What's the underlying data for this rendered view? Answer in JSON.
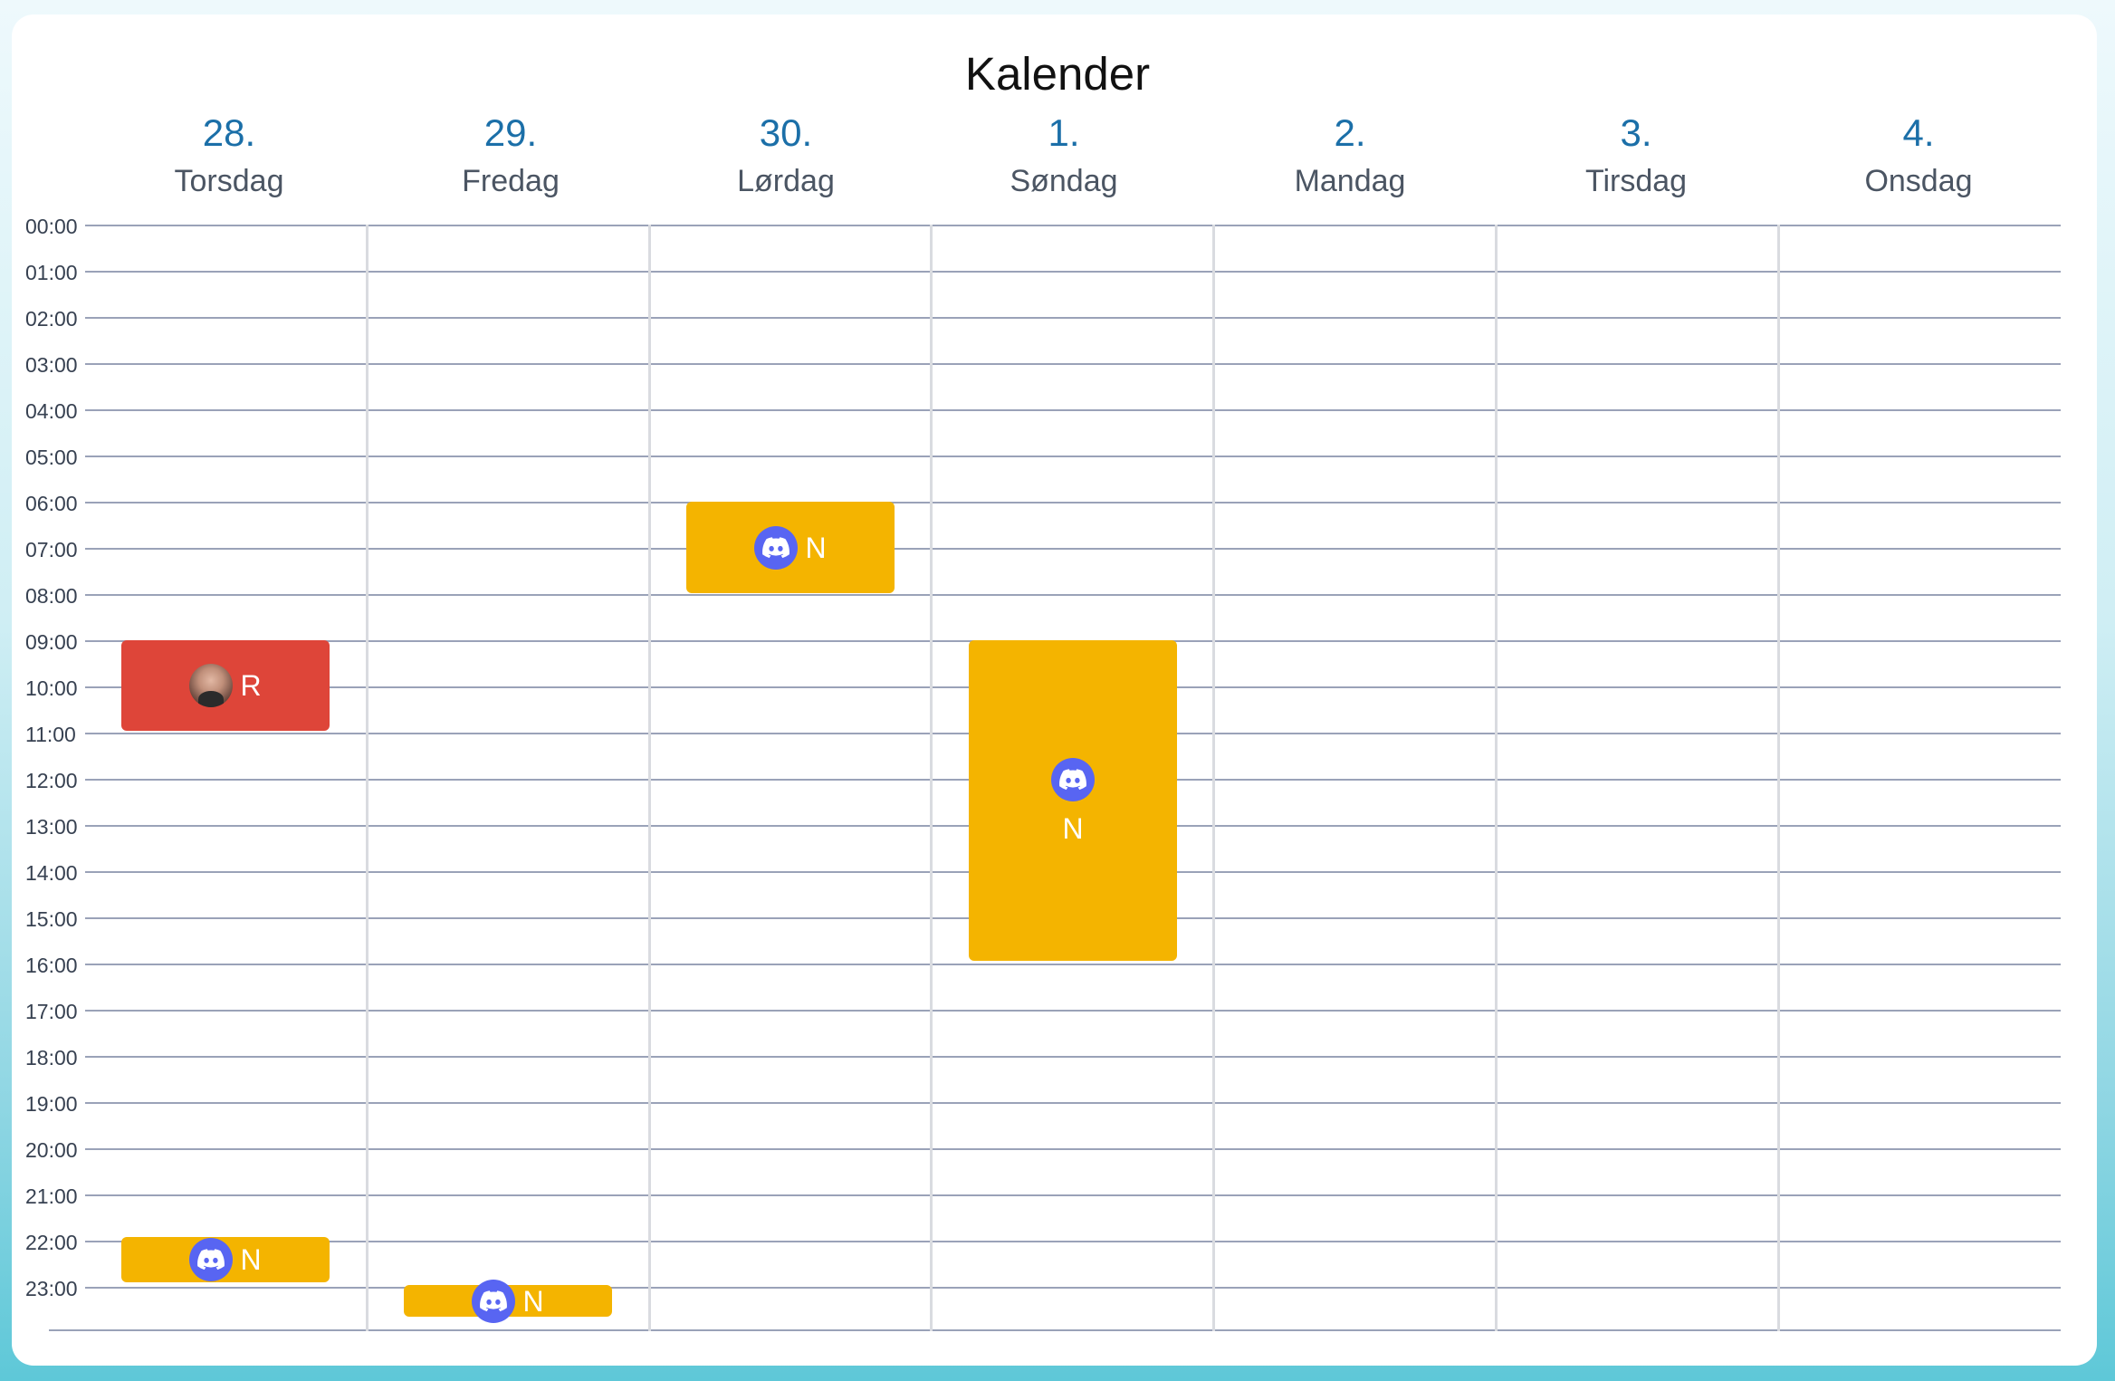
{
  "calendar": {
    "title": "Kalender",
    "days": [
      {
        "num": "28.",
        "name": "Torsdag"
      },
      {
        "num": "29.",
        "name": "Fredag"
      },
      {
        "num": "30.",
        "name": "Lørdag"
      },
      {
        "num": "1.",
        "name": "Søndag"
      },
      {
        "num": "2.",
        "name": "Mandag"
      },
      {
        "num": "3.",
        "name": "Tirsdag"
      },
      {
        "num": "4.",
        "name": "Onsdag"
      }
    ],
    "hours": [
      "00:00",
      "01:00",
      "02:00",
      "03:00",
      "04:00",
      "05:00",
      "06:00",
      "07:00",
      "08:00",
      "09:00",
      "10:00",
      "11:00",
      "12:00",
      "13:00",
      "14:00",
      "15:00",
      "16:00",
      "17:00",
      "18:00",
      "19:00",
      "20:00",
      "21:00",
      "22:00",
      "23:00"
    ],
    "events": [
      {
        "initial": "N",
        "icon": "discord-icon",
        "color": "#f4b400",
        "day": "30.",
        "start": "06:00",
        "end": "08:00"
      },
      {
        "initial": "R",
        "icon": "user-avatar",
        "color": "#de4539",
        "day": "28.",
        "start": "09:00",
        "end": "11:00"
      },
      {
        "initial": "N",
        "icon": "discord-icon",
        "color": "#f4b400",
        "day": "1.",
        "start": "09:00",
        "end": "16:00"
      },
      {
        "initial": "N",
        "icon": "discord-icon",
        "color": "#f4b400",
        "day": "28.",
        "start": "22:00",
        "end": "23:00"
      },
      {
        "initial": "N",
        "icon": "discord-icon",
        "color": "#f4b400",
        "day": "29.",
        "start": "23:00",
        "end": "23:45"
      }
    ]
  },
  "colors": {
    "accent_yellow": "#f4b400",
    "accent_red": "#de4539",
    "day_number_blue": "#1b6fa8",
    "discord_blue": "#5865f2"
  }
}
